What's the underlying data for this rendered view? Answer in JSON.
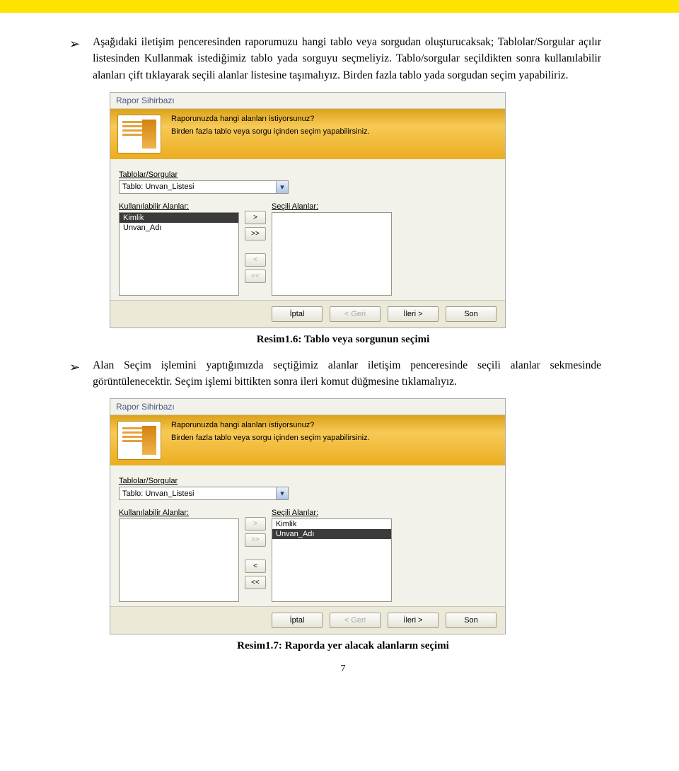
{
  "page_number": "7",
  "paragraphs": {
    "p1": "Aşağıdaki iletişim penceresinden raporumuzu hangi tablo veya sorgudan oluşturucaksak; Tablolar/Sorgular açılır listesinden Kullanmak istediğimiz tablo yada sorguyu seçmeliyiz. Tablo/sorgular seçildikten sonra kullanılabilir alanları çift tıklayarak seçili alanlar listesine taşımalıyız. Birden fazla tablo yada sorgudan seçim yapabiliriz.",
    "p2": "Alan Seçim işlemini yaptığımızda seçtiğimiz alanlar iletişim penceresinde seçili alanlar sekmesinde görüntülenecektir. Seçim işlemi bittikten sonra ileri komut düğmesine tıklamalıyız."
  },
  "captions": {
    "c1": "Resim1.6: Tablo veya sorgunun seçimi",
    "c2": "Resim1.7: Raporda yer alacak alanların seçimi"
  },
  "wizard": {
    "title": "Rapor Sihirbazı",
    "banner_q": "Raporunuzda hangi alanları istiyorsunuz?",
    "banner_s": "Birden fazla tablo veya sorgu içinden seçim yapabilirsiniz.",
    "label_tables": "Tablolar/Sorgular",
    "dropdown_value": "Tablo: Unvan_Listesi",
    "label_available": "Kullanılabilir Alanlar:",
    "label_selected": "Seçili Alanlar:",
    "btn_add": ">",
    "btn_addall": ">>",
    "btn_remove": "<",
    "btn_removeall": "<<",
    "footer_cancel": "İptal",
    "footer_back": "< Geri",
    "footer_next": "İleri >",
    "footer_finish": "Son"
  },
  "wizard1_items": {
    "available": [
      "Kimlik",
      "Unvan_Adı"
    ],
    "selected": []
  },
  "wizard2_items": {
    "available": [],
    "selected": [
      "Kimlik",
      "Unvan_Adı"
    ]
  }
}
